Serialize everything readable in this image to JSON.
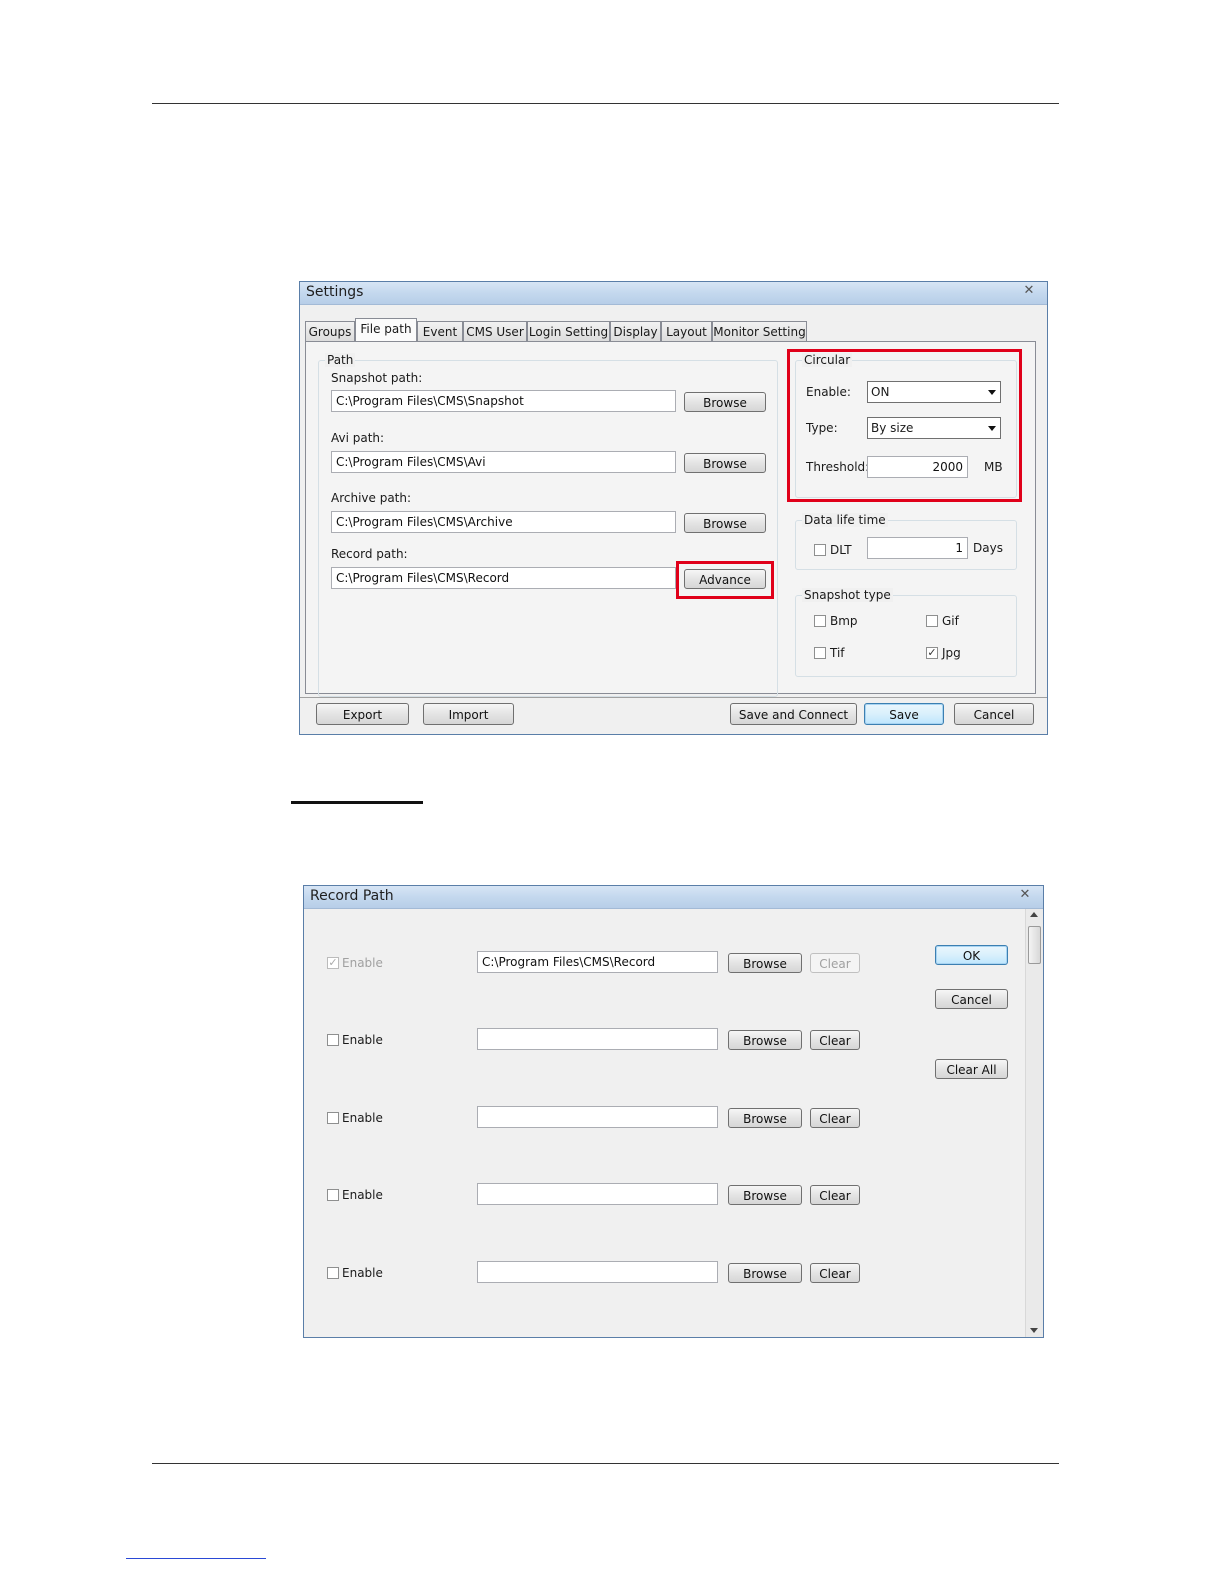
{
  "settings": {
    "title": "Settings",
    "tabs": [
      "Groups",
      "File path",
      "Event",
      "CMS User",
      "Login Setting",
      "Display",
      "Layout",
      "Monitor Setting"
    ],
    "path_group": {
      "legend": "Path",
      "snapshot_label": "Snapshot path:",
      "snapshot_value": "C:\\Program Files\\CMS\\Snapshot",
      "avi_label": "Avi path:",
      "avi_value": "C:\\Program Files\\CMS\\Avi",
      "archive_label": "Archive path:",
      "archive_value": "C:\\Program Files\\CMS\\Archive",
      "record_label": "Record path:",
      "record_value": "C:\\Program Files\\CMS\\Record",
      "browse_label": "Browse",
      "advance_label": "Advance"
    },
    "circular": {
      "legend": "Circular",
      "enable_label": "Enable:",
      "enable_value": "ON",
      "type_label": "Type:",
      "type_value": "By size",
      "threshold_label": "Threshold:",
      "threshold_value": "2000",
      "threshold_unit": "MB"
    },
    "data_life": {
      "legend": "Data life time",
      "dlt_label": "DLT",
      "days_value": "1",
      "days_unit": "Days"
    },
    "snapshot_type": {
      "legend": "Snapshot type",
      "bmp": "Bmp",
      "gif": "Gif",
      "tif": "Tif",
      "jpg": "Jpg"
    },
    "buttons": {
      "export": "Export",
      "import": "Import",
      "save_connect": "Save and Connect",
      "save": "Save",
      "cancel": "Cancel"
    }
  },
  "record_path": {
    "title": "Record Path",
    "enable_label": "Enable",
    "first_path": "C:\\Program Files\\CMS\\Record",
    "browse_label": "Browse",
    "clear_label": "Clear",
    "ok_label": "OK",
    "cancel_label": "Cancel",
    "clear_all_label": "Clear All"
  },
  "icons": {
    "close": "close-icon",
    "dropdown": "chevron-down-icon",
    "checkmark": "check-icon"
  },
  "colors": {
    "highlight": "#e0001a",
    "titlebar": "#c4d8ee"
  }
}
